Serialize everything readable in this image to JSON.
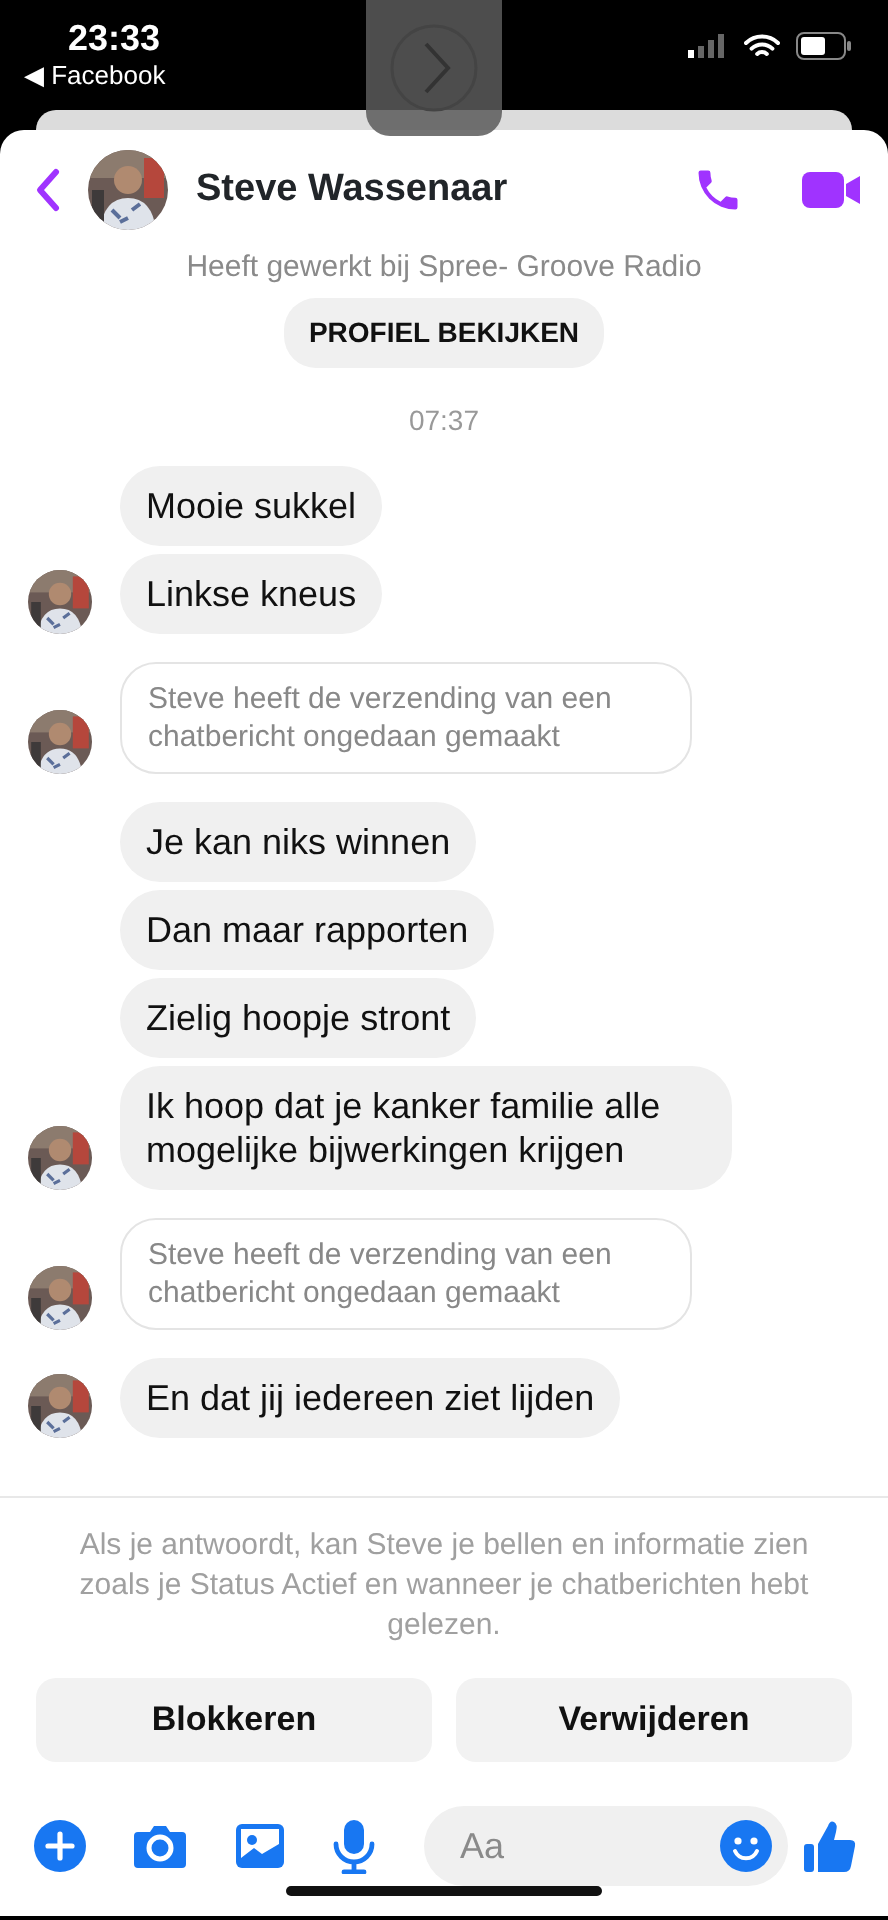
{
  "status_bar": {
    "time": "23:33",
    "back_app": "◀ Facebook"
  },
  "header": {
    "contact_name": "Steve Wassenaar"
  },
  "profile": {
    "subtitle": "Heeft gewerkt bij Spree- Groove Radio",
    "button": "PROFIEL BEKIJKEN"
  },
  "timestamp": "07:37",
  "messages": [
    {
      "kind": "text",
      "text": "Mooie sukkel",
      "avatar": false
    },
    {
      "kind": "text",
      "text": "Linkse kneus",
      "avatar": true
    },
    {
      "kind": "unsent",
      "text": "Steve heeft de verzending van een chatbericht ongedaan gemaakt",
      "avatar": true
    },
    {
      "kind": "text",
      "text": "Je kan niks winnen",
      "avatar": false
    },
    {
      "kind": "text",
      "text": "Dan maar rapporten",
      "avatar": false
    },
    {
      "kind": "text",
      "text": "Zielig hoopje stront",
      "avatar": false
    },
    {
      "kind": "text",
      "text": "Ik hoop dat je kanker familie alle mogelijke bijwerkingen krijgen",
      "avatar": true
    },
    {
      "kind": "unsent",
      "text": "Steve heeft de verzending van een chatbericht ongedaan gemaakt",
      "avatar": true
    },
    {
      "kind": "text",
      "text": "En dat jij iedereen ziet lijden",
      "avatar": true
    }
  ],
  "notice": "Als je antwoordt, kan Steve je bellen en informatie zien zoals je Status Actief en wanneer je chatberichten hebt gelezen.",
  "actions": [
    "Blokkeren",
    "Verwijderen"
  ],
  "composer": {
    "placeholder": "Aa"
  }
}
